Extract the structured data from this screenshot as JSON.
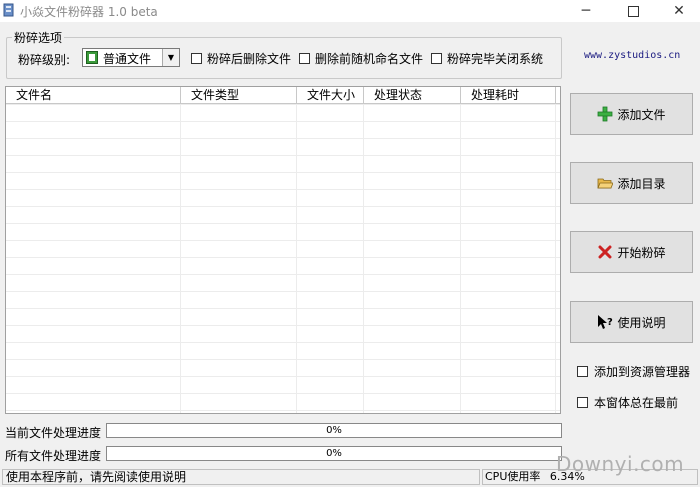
{
  "window": {
    "title": "小焱文件粉碎器 1.0 beta"
  },
  "options": {
    "group_title": "粉碎选项",
    "level_label": "粉碎级别:",
    "level_value": "普通文件",
    "after_delete_label": "粉碎后删除文件",
    "rename_label": "删除前随机命名文件",
    "shutdown_label": "粉碎完毕关闭系统"
  },
  "website": "www.zystudios.cn",
  "file_list": {
    "columns": [
      "文件名",
      "文件类型",
      "文件大小",
      "处理状态",
      "处理耗时"
    ],
    "rows": []
  },
  "buttons": {
    "add_file": "添加文件",
    "add_folder": "添加目录",
    "start": "开始粉碎",
    "help": "使用说明"
  },
  "side_options": {
    "explorer_label": "添加到资源管理器",
    "topmost_label": "本窗体总在最前"
  },
  "progress": {
    "current_label": "当前文件处理进度",
    "current_value": "0%",
    "all_label": "所有文件处理进度",
    "all_value": "0%"
  },
  "status": {
    "message": "使用本程序前，请先阅读使用说明",
    "cpu_label": "CPU使用率",
    "cpu_value": "6.34%"
  },
  "watermark": "Downyi.com",
  "colors": {
    "add_icon": "#3cb043",
    "delete_icon": "#cc2222",
    "folder_icon": "#e8b84a",
    "link": "#1a1a80"
  }
}
